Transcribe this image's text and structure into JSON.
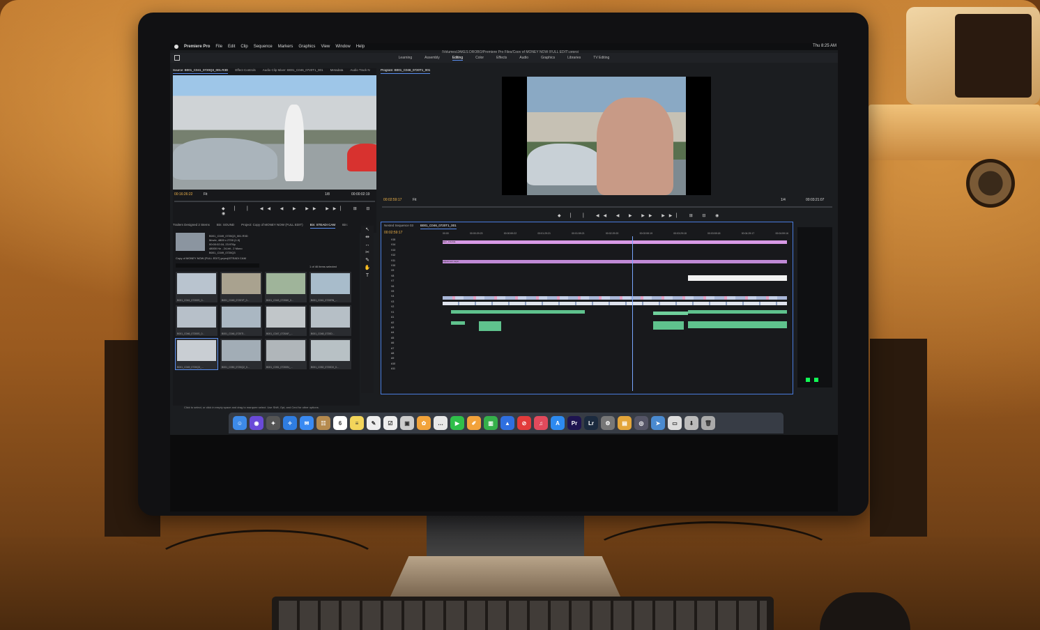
{
  "menubar": {
    "app_name": "Premiere Pro",
    "items": [
      "File",
      "Edit",
      "Clip",
      "Sequence",
      "Markers",
      "Graphics",
      "View",
      "Window",
      "Help"
    ],
    "clock": "Thu 8:25 AM"
  },
  "document_title": "/Volumes/JAKES DROBO/Premiere Pro Files/Copy of MONEY NOW (FULL EDIT).prproj",
  "workspaces": {
    "tabs": [
      "Learning",
      "Assembly",
      "Editing",
      "Color",
      "Effects",
      "Audio",
      "Graphics",
      "Libraries",
      "TV Editing"
    ],
    "active": "Editing"
  },
  "source_monitor": {
    "tabs": [
      "Source: B001_C041_0720Q3_001.R3D",
      "Effect Controls",
      "Audio Clip Mixer: B001_C046_0720T1_001",
      "Metadata",
      "Audio Track N"
    ],
    "timecode_in": "00:16:26:22",
    "fit": "Fit",
    "ratio": "1/8",
    "timecode_dur": "00:00:02:19"
  },
  "program_monitor": {
    "tab": "Program: B001_C046_0720T1_001",
    "timecode": "00:02:59:17",
    "fit": "Fit",
    "ratio": "1/4",
    "duration": "00:03:21:07"
  },
  "project_panel": {
    "tabs": [
      "Trailers Designed 2 Stems",
      "Bin: SOUND",
      "Project: Copy of MONEY NOW (FULL EDIT)",
      "Bin: STEADI CAM",
      "Bin:"
    ],
    "clip_name": "B001_C049_0720Q3_001.R3D",
    "clip_info": [
      "Movie, 4800 x 2700 (1.0)",
      "00:00:02:16, 23.976p",
      "48000 Hz - 24-bit - 2 Mono",
      "B001_C049_0720Q3"
    ],
    "path": "Copy of MONEY NOW (FULL EDIT).prproj\\STEADI CAM",
    "item_count": "1 of 46 items selected",
    "thumbnails": [
      {
        "label": "B001_C041_07200S_0...",
        "dur": "1:14"
      },
      {
        "label": "B001_C049_0720YF_0...",
        "dur": "2:22"
      },
      {
        "label": "B001_C043_072060_0...",
        "dur": "8:16"
      },
      {
        "label": "B001_C041_0720RN_...",
        "dur": "0:22"
      },
      {
        "label": "B001_C046_07200S_0...",
        "dur": "1:08"
      },
      {
        "label": "B001_C046_0720TI...",
        "dur": "1:11:21"
      },
      {
        "label": "B001_C047_0720AF_...",
        "dur": "1:22"
      },
      {
        "label": "B001_C048_0720D...",
        "dur": "8:16"
      },
      {
        "label": "B001_C049_0720Q3_...",
        "dur": "2:16"
      },
      {
        "label": "B001_C050_0720Q2_0...",
        "dur": "3:20"
      },
      {
        "label": "B001_C051_07200N_...",
        "dur": "07:02"
      },
      {
        "label": "B001_C052_0720DX_0...",
        "dur": "3:23"
      }
    ]
  },
  "timeline": {
    "tabs": [
      "Nested Sequence 03",
      "B001_C046_0720T1_001"
    ],
    "timecode": "00:02:59:17",
    "ruler": [
      "00:00",
      "00:00:29:23",
      "00:00:59:22",
      "00:01:29:21",
      "00:01:59:21",
      "00:02:29:20",
      "00:02:59:19",
      "00:03:29:18",
      "00:03:59:18",
      "00:04:29:17",
      "00:04:59:16"
    ],
    "video_tracks": [
      "V15",
      "V14",
      "V13",
      "V12",
      "V11",
      "V10",
      "V9",
      "V8",
      "V7",
      "V6",
      "V5",
      "V4",
      "V3",
      "V2",
      "V1"
    ],
    "audio_tracks": [
      "A1",
      "A2",
      "A3",
      "A4",
      "A5",
      "A6",
      "A7",
      "A8",
      "A9",
      "A10",
      "A11"
    ],
    "clip_labels": [
      "REC_FRAME",
      "Adjustment Layer"
    ]
  },
  "statusbar": "Click to select, or click in empty space and drag to marquee select. Use Shift, Opt, and Cmd for other options.",
  "dock": {
    "apps": [
      {
        "name": "Finder",
        "glyph": "☺",
        "color": "#3d8ae8"
      },
      {
        "name": "Siri",
        "glyph": "◉",
        "color": "#6a4ad8"
      },
      {
        "name": "Launchpad",
        "glyph": "✦",
        "color": "#555"
      },
      {
        "name": "Safari",
        "glyph": "✧",
        "color": "#2f7de1"
      },
      {
        "name": "Mail",
        "glyph": "✉",
        "color": "#3a8af2"
      },
      {
        "name": "Contacts",
        "glyph": "☷",
        "color": "#b58a4e"
      },
      {
        "name": "Calendar",
        "glyph": "6",
        "color": "#ffffff"
      },
      {
        "name": "Notes",
        "glyph": "≡",
        "color": "#f3d55b"
      },
      {
        "name": "TextEdit",
        "glyph": "✎",
        "color": "#eee"
      },
      {
        "name": "Reminders",
        "glyph": "☑",
        "color": "#eee"
      },
      {
        "name": "Preview",
        "glyph": "▣",
        "color": "#ccc"
      },
      {
        "name": "Photos",
        "glyph": "✿",
        "color": "#f2a33a"
      },
      {
        "name": "Messages",
        "glyph": "…",
        "color": "#e8e8e8"
      },
      {
        "name": "FaceTime",
        "glyph": "▶",
        "color": "#2fbf4a"
      },
      {
        "name": "Pages",
        "glyph": "✐",
        "color": "#f2a23a"
      },
      {
        "name": "Numbers",
        "glyph": "▥",
        "color": "#35b04a"
      },
      {
        "name": "Keynote",
        "glyph": "▲",
        "color": "#2f6fe0"
      },
      {
        "name": "News",
        "glyph": "⊘",
        "color": "#e23b3b"
      },
      {
        "name": "Music",
        "glyph": "♫",
        "color": "#e24a5c"
      },
      {
        "name": "App Store",
        "glyph": "A",
        "color": "#2d8af0"
      },
      {
        "name": "Premiere Pro",
        "glyph": "Pr",
        "color": "#1e1450"
      },
      {
        "name": "Lightroom",
        "glyph": "Lr",
        "color": "#1b2a3e"
      },
      {
        "name": "System Preferences",
        "glyph": "⚙",
        "color": "#777"
      },
      {
        "name": "Folder",
        "glyph": "▤",
        "color": "#e3a53a"
      },
      {
        "name": "Disk Utility",
        "glyph": "◎",
        "color": "#556"
      },
      {
        "name": "Migration",
        "glyph": "➤",
        "color": "#4a8ad0"
      },
      {
        "name": "Terminal",
        "glyph": "▭",
        "color": "#ddd"
      },
      {
        "name": "Downloads",
        "glyph": "⬇",
        "color": "#bbb"
      },
      {
        "name": "Trash",
        "glyph": "🗑",
        "color": "#aaa"
      }
    ]
  }
}
